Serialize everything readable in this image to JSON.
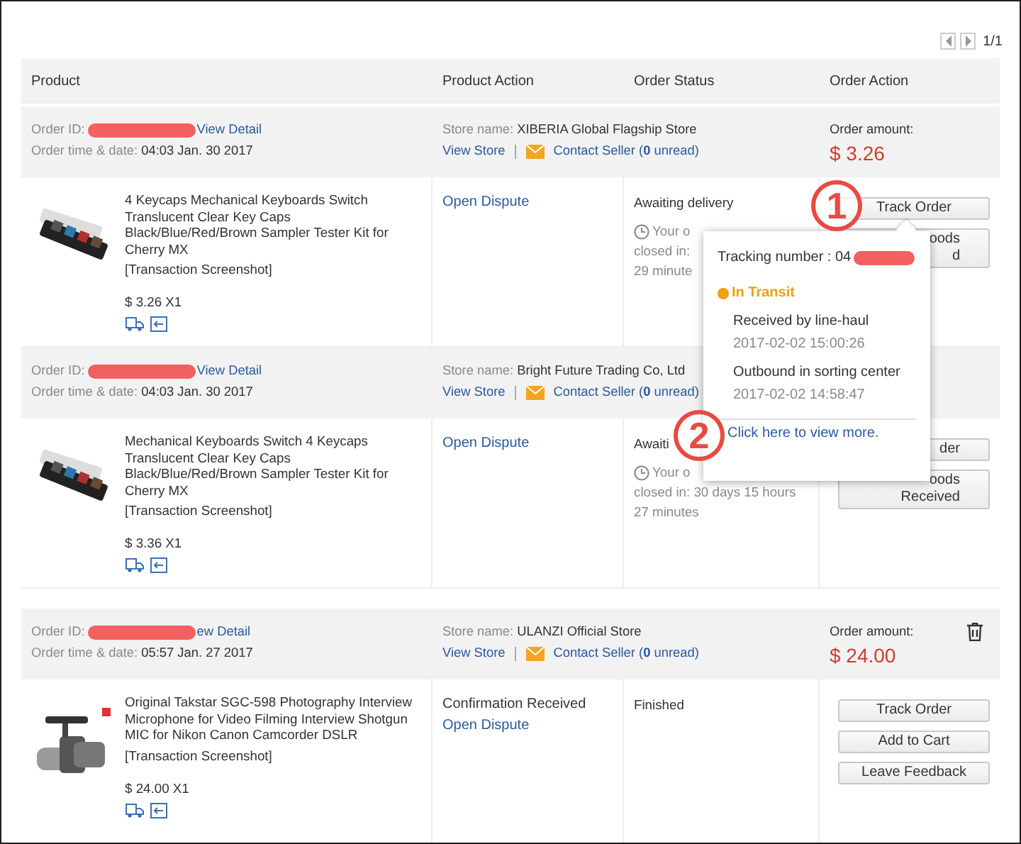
{
  "pager": {
    "page": "1/1"
  },
  "columns": [
    "Product",
    "Product Action",
    "Order Status",
    "Order Action"
  ],
  "orders": [
    {
      "order_id_label": "Order ID:",
      "view_detail": "View Detail",
      "date_label": "Order time & date:",
      "date": "04:03 Jan. 30 2017",
      "store_label": "Store name:",
      "store": "XIBERIA Global Flagship Store",
      "view_store": "View Store",
      "contact": "Contact Seller",
      "unread": "(**0** unread)",
      "amount_label": "Order amount:",
      "amount": "$ 3.26",
      "deletable": false,
      "product": {
        "title": "4 Keycaps Mechanical Keyboards Switch Translucent Clear Key Caps Black/Blue/Red/Brown Sampler Tester Kit for Cherry MX",
        "screenshot": "[Transaction Screenshot]",
        "price": "$ 3.26 X1"
      },
      "product_actions": [
        {
          "kind": "link",
          "text": "Open Dispute"
        }
      ],
      "status": "Awaiting delivery",
      "countdown": [
        "Your o",
        "closed in:",
        "29 minute"
      ],
      "buttons": [
        {
          "kind": "full",
          "lines": [
            "Track Order"
          ]
        },
        {
          "kind": "partial",
          "lines": [
            "oods",
            "d"
          ]
        }
      ]
    },
    {
      "order_id_label": "Order ID:",
      "view_detail": "View Detail",
      "date_label": "Order time & date:",
      "date": "04:03 Jan. 30 2017",
      "store_label": "Store name:",
      "store": "Bright Future Trading Co, Ltd",
      "view_store": "View Store",
      "contact": "Contact Seller",
      "unread": "(**0** unread)",
      "product": {
        "title": "Mechanical Keyboards Switch 4 Keycaps Translucent Clear Key Caps Black/Blue/Red/Brown Sampler Tester Kit for Cherry MX",
        "screenshot": "[Transaction Screenshot]",
        "price": "$ 3.36 X1"
      },
      "product_actions": [
        {
          "kind": "link",
          "text": "Open Dispute"
        }
      ],
      "status": "Awaiti",
      "countdown": [
        "Your o",
        "closed in: 30 days 15 hours",
        "27 minutes"
      ],
      "buttons": [
        {
          "kind": "partial",
          "lines": [
            "der"
          ]
        },
        {
          "kind": "partial",
          "lines": [
            "oods",
            "Received"
          ]
        }
      ]
    },
    {
      "order_id_label": "Order ID:",
      "view_detail": "ew Detail",
      "date_label": "Order time & date:",
      "date": "05:57 Jan. 27 2017",
      "store_label": "Store name:",
      "store": "ULANZI Official Store",
      "view_store": "View Store",
      "contact": "Contact Seller",
      "unread": "(**0** unread)",
      "amount_label": "Order amount:",
      "amount": "$ 24.00",
      "deletable": true,
      "product": {
        "title": "Original Takstar SGC-598 Photography Interview Microphone for Video Filming Interview Shotgun MIC for Nikon Canon Camcorder DSLR",
        "screenshot": "[Transaction Screenshot]",
        "price": "$ 24.00 X1"
      },
      "product_actions": [
        {
          "kind": "text",
          "text": "Confirmation Received"
        },
        {
          "kind": "link",
          "text": "Open Dispute"
        }
      ],
      "status": "Finished",
      "buttons": [
        {
          "kind": "full",
          "lines": [
            "Track Order"
          ]
        },
        {
          "kind": "full",
          "lines": [
            "Add to Cart"
          ]
        },
        {
          "kind": "full",
          "lines": [
            "Leave Feedback"
          ]
        }
      ]
    }
  ],
  "tracking_popup": {
    "label": "Tracking number : 04",
    "status": "In Transit",
    "events": [
      {
        "title": "Received by line-haul",
        "time": "2017-02-02 15:00:26"
      },
      {
        "title": "Outbound in sorting center",
        "time": "2017-02-02 14:58:47"
      }
    ],
    "more_link": "Click here to view more."
  },
  "annotations": [
    {
      "number": "1"
    },
    {
      "number": "2"
    }
  ]
}
